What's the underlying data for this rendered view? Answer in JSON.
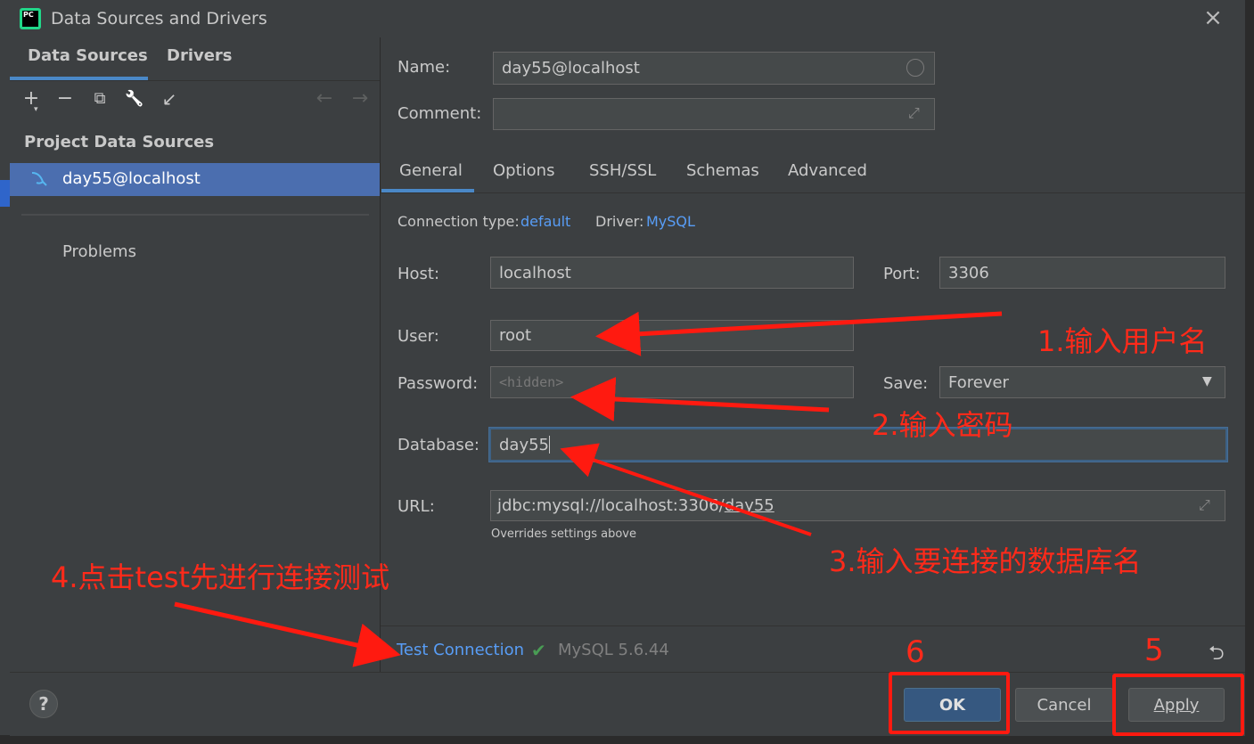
{
  "window": {
    "title": "Data Sources and Drivers",
    "logo_text": "PC"
  },
  "left_tabs": [
    "Data Sources",
    "Drivers"
  ],
  "toolbar": {
    "add": "+",
    "remove": "−",
    "copy": "⧉",
    "wrench": "🔧",
    "import": "↙",
    "back": "←",
    "forward": "→"
  },
  "left": {
    "section_title": "Project Data Sources",
    "selected_item": "day55@localhost",
    "problems": "Problems"
  },
  "form": {
    "name_label": "Name:",
    "name_value": "day55@localhost",
    "comment_label": "Comment:",
    "comment_value": "",
    "tabs": [
      "General",
      "Options",
      "SSH/SSL",
      "Schemas",
      "Advanced"
    ],
    "connection_type_label": "Connection type:",
    "connection_type_value": "default",
    "driver_label": "Driver:",
    "driver_value": "MySQL",
    "host_label": "Host:",
    "host_value": "localhost",
    "port_label": "Port:",
    "port_value": "3306",
    "user_label": "User:",
    "user_value": "root",
    "password_label": "Password:",
    "password_placeholder": "<hidden>",
    "save_label": "Save:",
    "save_value": "Forever",
    "database_label": "Database:",
    "database_value": "day55",
    "url_label": "URL:",
    "url_prefix": "jdbc:mysql://localhost:3306/",
    "url_db": "day55",
    "url_hint": "Overrides settings above"
  },
  "test": {
    "link": "Test Connection",
    "status": "MySQL 5.6.44"
  },
  "buttons": {
    "ok": "OK",
    "cancel": "Cancel",
    "apply": "Apply",
    "help": "?"
  },
  "annotations": {
    "a1": "1.输入用户名",
    "a2": "2.输入密码",
    "a3": "3.输入要连接的数据库名",
    "a4": "4.点击test先进行连接测试",
    "a5": "5",
    "a6": "6"
  },
  "colors": {
    "accent": "#4a88c7",
    "link": "#589df6",
    "annotation": "#ff2a1a",
    "selection": "#4b6eaf"
  }
}
